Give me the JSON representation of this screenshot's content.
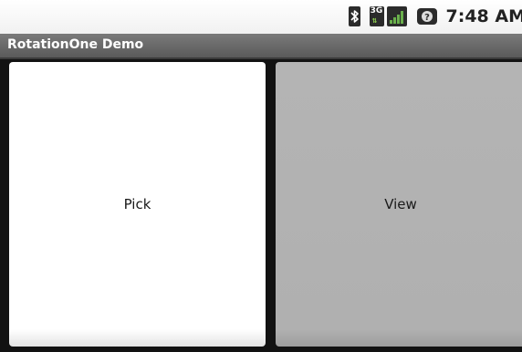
{
  "status_bar": {
    "time": "7:48 AM",
    "network_type": "3G",
    "icons": [
      "bluetooth-icon",
      "network-3g-icon",
      "signal-icon",
      "battery-icon"
    ]
  },
  "title_bar": {
    "title": "RotationOne Demo"
  },
  "content": {
    "pick_button_label": "Pick",
    "view_button_label": "View"
  }
}
